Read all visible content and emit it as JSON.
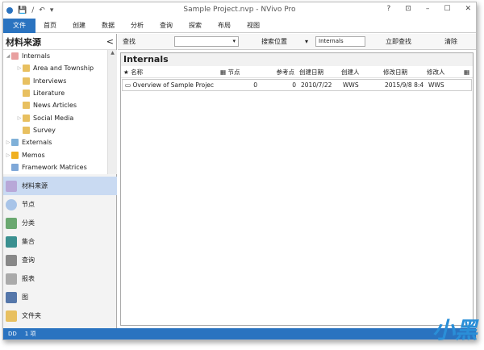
{
  "window": {
    "title": "Sample Project.nvp - NVivo Pro",
    "help": "?",
    "controls": [
      "⊡",
      "–",
      "☐",
      "✕"
    ]
  },
  "quick_access": [
    "💾",
    "/",
    "↶",
    "▾"
  ],
  "ribbon": {
    "file": "文件",
    "tabs": [
      "首页",
      "创建",
      "数据",
      "分析",
      "查询",
      "探索",
      "布局",
      "视图"
    ]
  },
  "left": {
    "title": "材料来源",
    "collapse": "<",
    "tree": [
      {
        "label": "Internals",
        "level": 0,
        "expander": "◢",
        "color": "#e8a0a0"
      },
      {
        "label": "Area and Township",
        "level": 1,
        "expander": "▷",
        "color": "#e8c060"
      },
      {
        "label": "Interviews",
        "level": 1,
        "expander": "",
        "color": "#e8c060"
      },
      {
        "label": "Literature",
        "level": 1,
        "expander": "",
        "color": "#e8c060"
      },
      {
        "label": "News Articles",
        "level": 1,
        "expander": "",
        "color": "#e8c060"
      },
      {
        "label": "Social Media",
        "level": 1,
        "expander": "▷",
        "color": "#e8c060"
      },
      {
        "label": "Survey",
        "level": 1,
        "expander": "",
        "color": "#e8c060"
      },
      {
        "label": "Externals",
        "level": 0,
        "expander": "▷",
        "color": "#7fb0d8"
      },
      {
        "label": "Memos",
        "level": 0,
        "expander": "▷",
        "color": "#f0b020"
      },
      {
        "label": "Framework Matrices",
        "level": 0,
        "expander": "",
        "color": "#7fa8d8"
      }
    ],
    "nav": [
      {
        "label": "材料来源",
        "icon": "sources-icon",
        "active": true
      },
      {
        "label": "节点",
        "icon": "node-icon"
      },
      {
        "label": "分类",
        "icon": "classification-icon"
      },
      {
        "label": "集合",
        "icon": "collection-icon"
      },
      {
        "label": "查询",
        "icon": "query-icon"
      },
      {
        "label": "报表",
        "icon": "report-icon"
      },
      {
        "label": "图",
        "icon": "map-icon"
      },
      {
        "label": "文件夹",
        "icon": "folder-icon"
      }
    ]
  },
  "search": {
    "find_label": "查找",
    "find_value": "",
    "location_label": "搜索位置",
    "location_value": "Internals",
    "find_now": "立即查找",
    "clear": "清除"
  },
  "list": {
    "title": "Internals",
    "columns": [
      "名称",
      "节点",
      "参考点",
      "创建日期",
      "创建人",
      "修改日期",
      "修改人"
    ],
    "rows": [
      {
        "name": "Overview of Sample Projec",
        "nodes": "0",
        "refs": "0",
        "created": "2010/7/22",
        "creator": "WWS",
        "modified": "2015/9/8 8:4",
        "modifier": "WWS"
      }
    ]
  },
  "status": {
    "user": "DD",
    "count": "1 项"
  },
  "watermark": "小黑游戏"
}
